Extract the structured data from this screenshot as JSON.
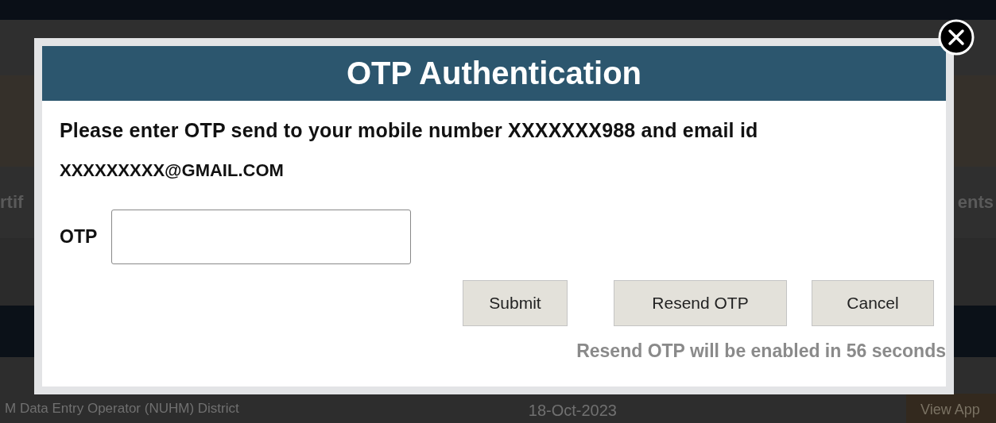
{
  "background": {
    "nav_left": "rtif",
    "nav_right": "ents",
    "row": {
      "title": "M Data Entry Operator (NUHM) District",
      "date": "18-Oct-2023",
      "action": "View App"
    }
  },
  "dialog": {
    "title": "OTP Authentication",
    "message": "Please enter OTP send to your mobile number XXXXXXX988 and email id",
    "email": "XXXXXXXXX@GMAIL.COM",
    "otp_field": {
      "label": "OTP"
    },
    "buttons": [
      "Submit",
      "Resend OTP",
      "Cancel"
    ],
    "note": "Resend OTP will be enabled in 56 seconds"
  }
}
